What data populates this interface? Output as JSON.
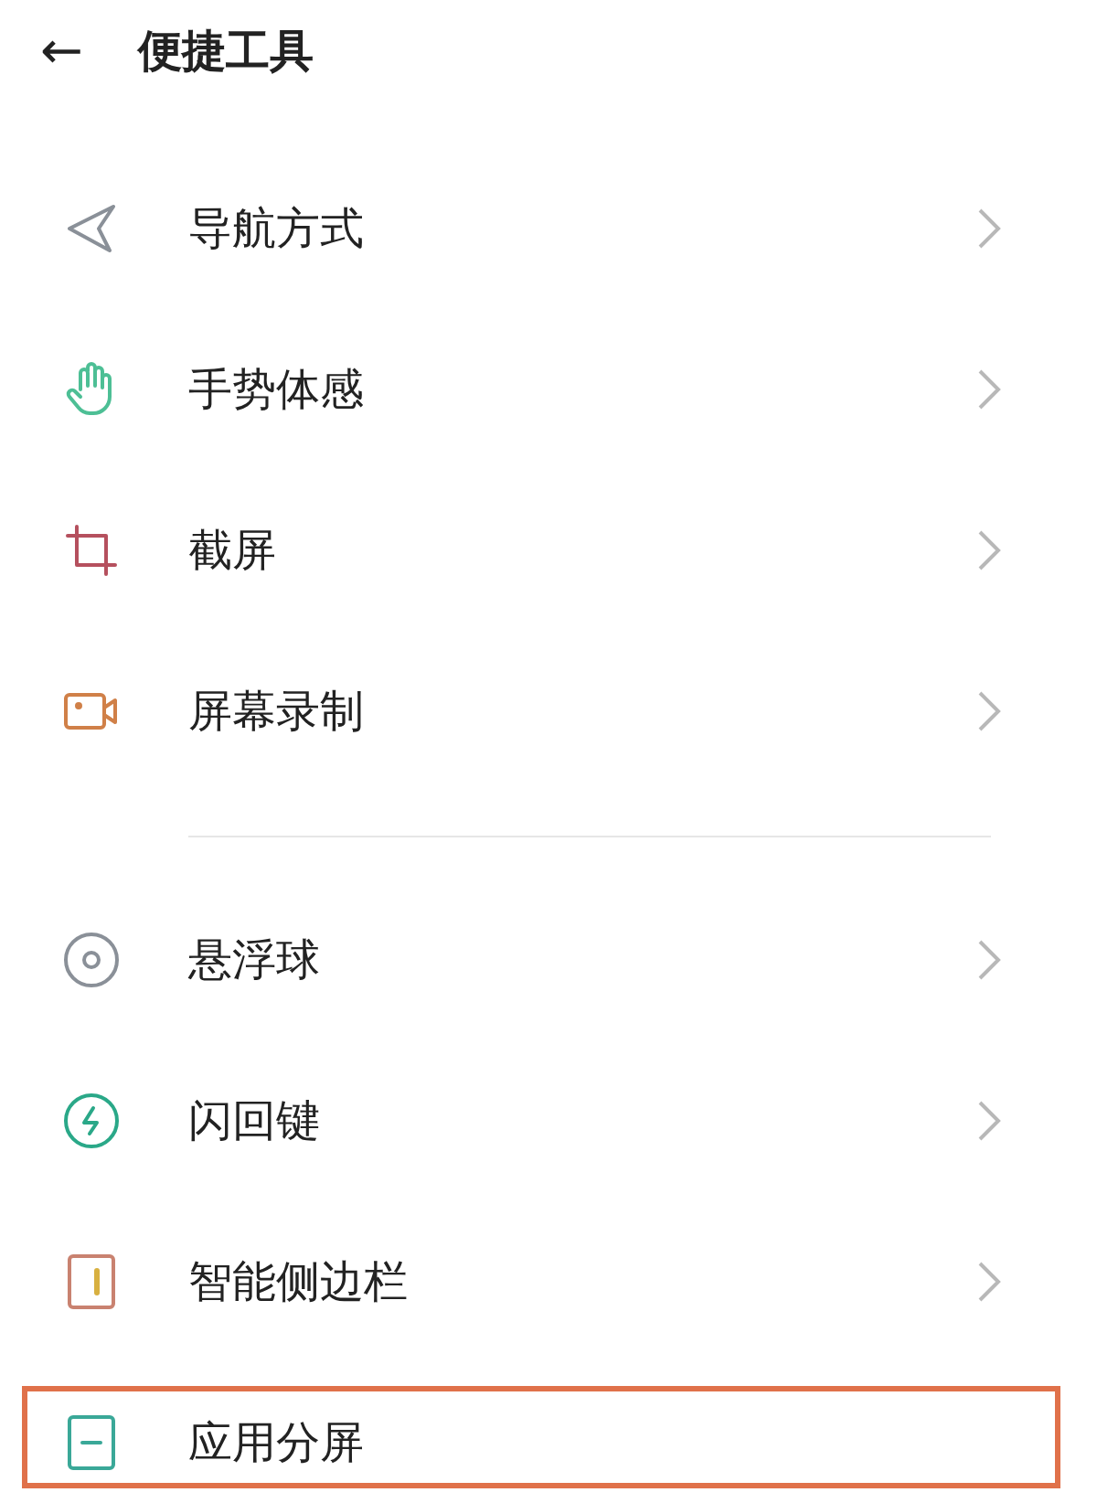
{
  "header": {
    "back_icon": "←",
    "title": "便捷工具"
  },
  "sections": [
    {
      "items": [
        {
          "kind": "navigation",
          "label": "导航方式",
          "chevron": true,
          "highlighted": false
        },
        {
          "kind": "gesture",
          "label": "手势体感",
          "chevron": true,
          "highlighted": false
        },
        {
          "kind": "screenshot",
          "label": "截屏",
          "chevron": true,
          "highlighted": false
        },
        {
          "kind": "record",
          "label": "屏幕录制",
          "chevron": true,
          "highlighted": false
        }
      ]
    },
    {
      "items": [
        {
          "kind": "floating",
          "label": "悬浮球",
          "chevron": true,
          "highlighted": false
        },
        {
          "kind": "flash",
          "label": "闪回键",
          "chevron": true,
          "highlighted": false
        },
        {
          "kind": "sidebar",
          "label": "智能侧边栏",
          "chevron": true,
          "highlighted": false
        },
        {
          "kind": "split",
          "label": "应用分屏",
          "chevron": false,
          "highlighted": true
        }
      ]
    }
  ]
}
